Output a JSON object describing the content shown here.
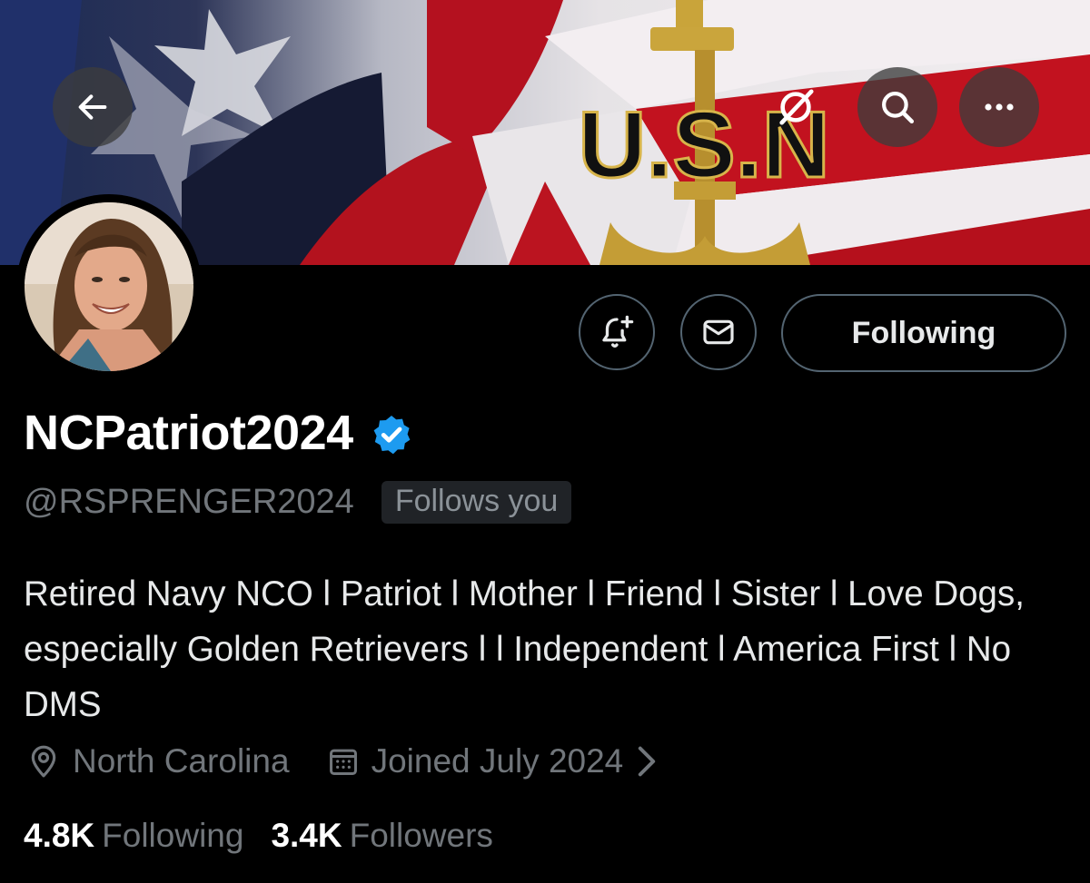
{
  "banner": {
    "emblem_text": "U.S.N"
  },
  "nav": {
    "back_icon": "arrow-left-icon",
    "grok_icon": "grok-icon",
    "search_icon": "search-icon",
    "more_icon": "more-horizontal-icon"
  },
  "actions": {
    "notify_icon": "bell-plus-icon",
    "message_icon": "envelope-icon",
    "following_label": "Following"
  },
  "profile": {
    "display_name": "NCPatriot2024",
    "verified": true,
    "handle": "@RSPRENGER2024",
    "follows_you": "Follows you",
    "bio": "Retired Navy NCO l Patriot l Mother l Friend l Sister l Love Dogs, especially Golden Retrievers l l Independent l America First l No DMS",
    "location": "North Carolina",
    "joined": "Joined July 2024",
    "following_count": "4.8K",
    "following_label": "Following",
    "followers_count": "3.4K",
    "followers_label": "Followers"
  },
  "colors": {
    "background": "#000000",
    "text_primary": "#e7e9ea",
    "text_secondary": "#71767b",
    "border": "#536471",
    "verified_blue": "#1d9bf0"
  }
}
